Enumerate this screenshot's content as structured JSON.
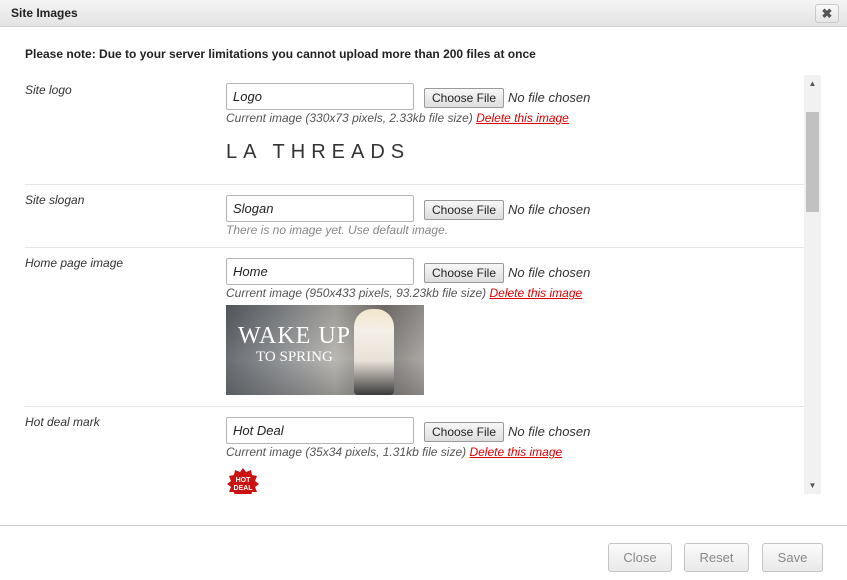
{
  "dialog": {
    "title": "Site Images",
    "close_icon": "close-icon",
    "note": "Please note: Due to your server limitations you cannot upload more than 200 files at once"
  },
  "rows": [
    {
      "label": "Site logo",
      "input_value": "Logo",
      "file_button": "Choose File",
      "file_status": "No file chosen",
      "info": "Current image (330x73 pixels, 2.33kb file size)",
      "delete_link": "Delete this image",
      "preview_text": "LA THREADS"
    },
    {
      "label": "Site slogan",
      "input_value": "Slogan",
      "file_button": "Choose File",
      "file_status": "No file chosen",
      "info": "There is no image yet. Use default image."
    },
    {
      "label": "Home page image",
      "input_value": "Home",
      "file_button": "Choose File",
      "file_status": "No file chosen",
      "info": "Current image (950x433 pixels, 93.23kb file size)",
      "delete_link": "Delete this image",
      "preview_line1": "WAKE UP",
      "preview_line2": "TO SPRING"
    },
    {
      "label": "Hot deal mark",
      "input_value": "Hot Deal",
      "file_button": "Choose File",
      "file_status": "No file chosen",
      "info": "Current image (35x34 pixels, 1.31kb file size)",
      "delete_link": "Delete this image",
      "badge_line1": "HOT",
      "badge_line2": "DEAL"
    }
  ],
  "footer": {
    "close_label": "Close",
    "reset_label": "Reset",
    "save_label": "Save"
  },
  "colors": {
    "delete_link": "#dd0000",
    "badge": "#cc1111"
  }
}
